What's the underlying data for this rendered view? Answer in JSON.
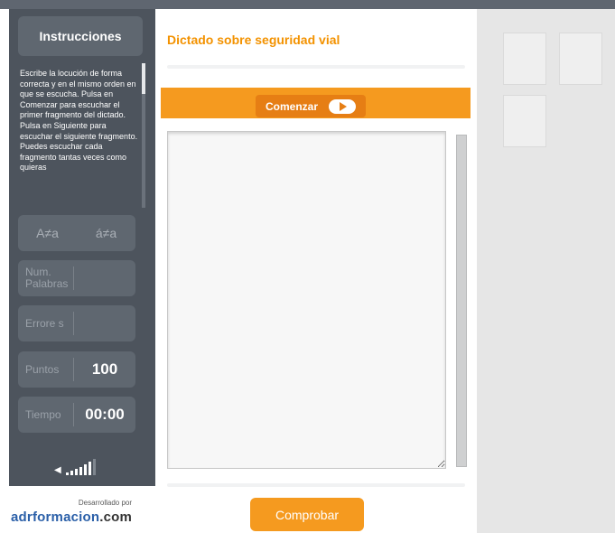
{
  "left_panel": {
    "instructions_title": "Instrucciones",
    "instructions_text": "Escribe la locución de forma correcta y en el mismo orden en que se escucha. Pulsa en Comenzar para escuchar el primer fragmento del dictado. Pulsa en Siguiente para escuchar el siguiente fragmento. Puedes escuchar cada fragmento tantas veces como quieras",
    "accent_toggle_1": "A≠a",
    "accent_toggle_2": "á≠a",
    "stats": {
      "words_label": "Num. Palabras",
      "words_value": "",
      "errors_label": "Errore s",
      "errors_value": "",
      "points_label": "Puntos",
      "points_value": "100",
      "time_label": "Tiempo",
      "time_value": "00:00"
    },
    "volume": {
      "icon": "speaker-icon",
      "level_bars": 6,
      "total_bars": 7
    },
    "credit": {
      "developed_by": "Desarrollado por",
      "brand": "adrformacion",
      "brand_suffix": ".com"
    }
  },
  "main": {
    "title": "Dictado sobre seguridad vial",
    "start_label": "Comenzar",
    "start_icon": "play-icon",
    "dictation_text": "",
    "check_label": "Comprobar"
  },
  "colors": {
    "accent_orange": "#f59a1f",
    "title_orange": "#f39200",
    "left_panel_bg": "#4d545d",
    "right_panel_bg": "#e6e6e6"
  }
}
